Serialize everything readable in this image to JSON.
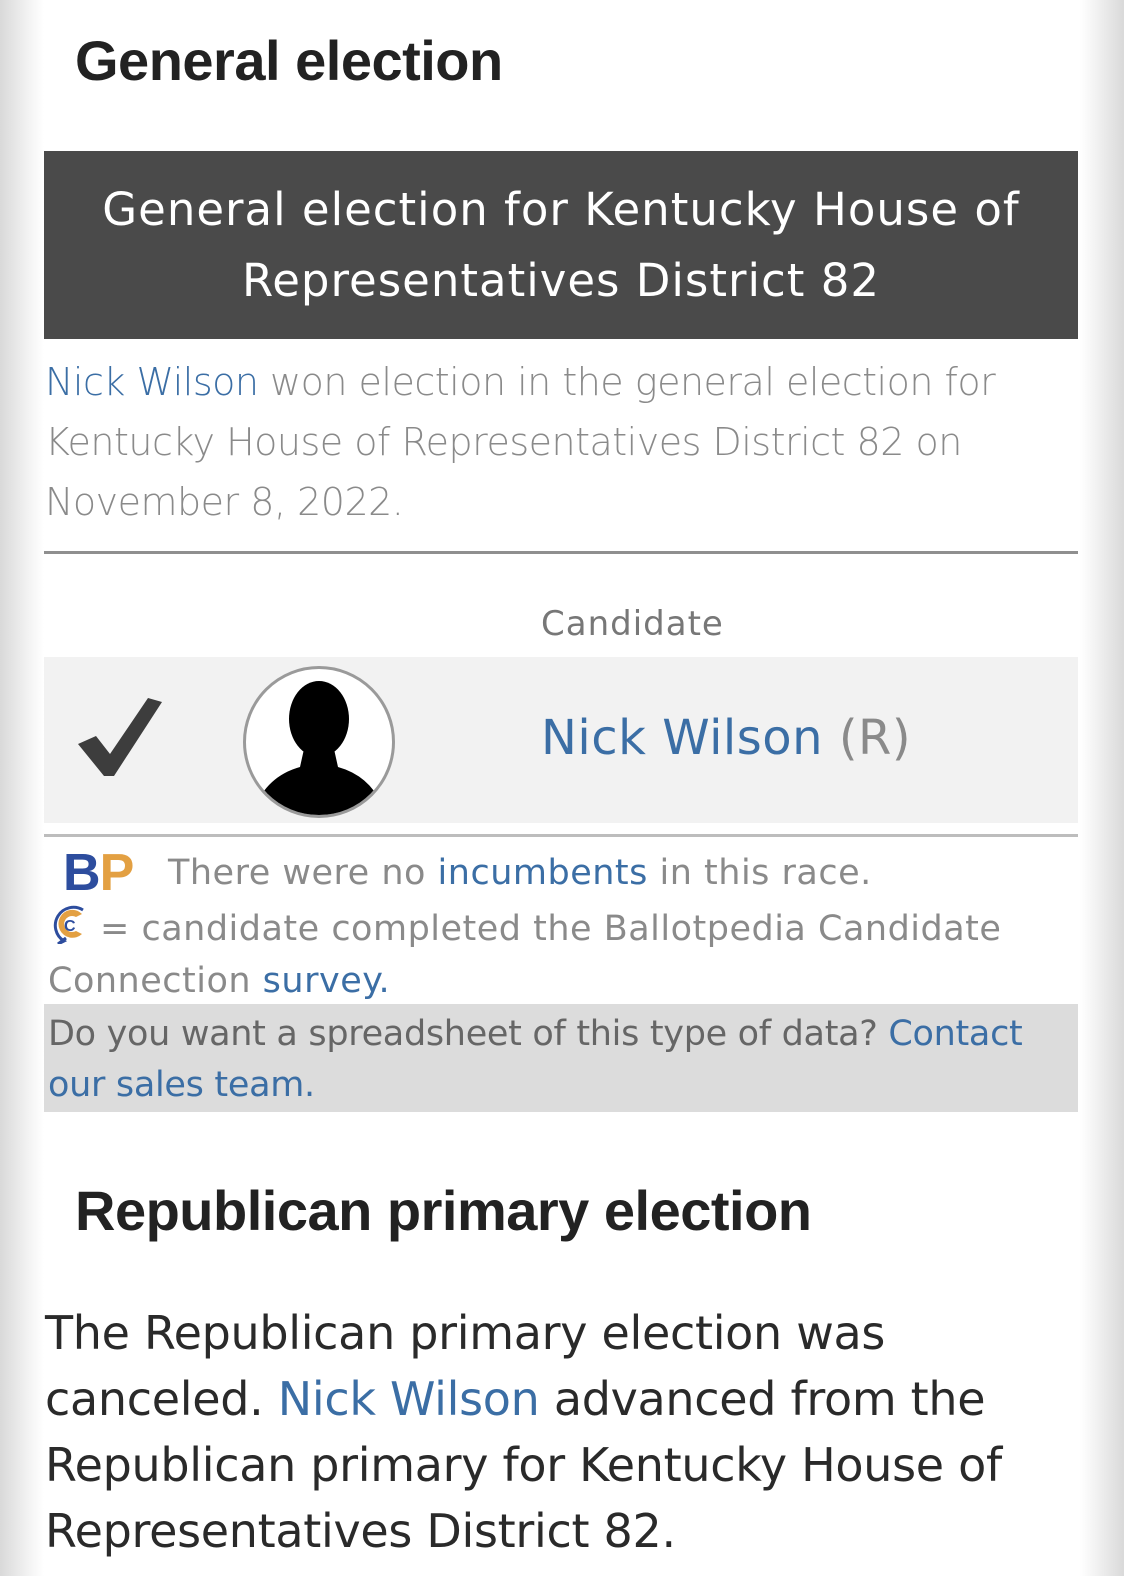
{
  "general": {
    "heading": "General election",
    "banner": "General election for Kentucky House of Representatives District 82",
    "result_link": "Nick Wilson",
    "result_text": " won election in the general election for Kentucky House of Representatives District 82 on November 8, 2022.",
    "column_header": "Candidate",
    "candidate": {
      "name": "Nick Wilson",
      "party": "(R)",
      "winner_icon": "checkmark-icon",
      "photo_icon": "person-silhouette-icon"
    },
    "incumbent_pre": "There were no ",
    "incumbent_link": "incumbents",
    "incumbent_post": " in this race.",
    "survey_text": "= candidate completed the Ballotpedia Candidate Connection ",
    "survey_link": "survey.",
    "sales_text": "Do you want a spreadsheet of this type of data? ",
    "sales_link": "Contact our sales team."
  },
  "logo": {
    "b": "B",
    "p": "P"
  },
  "primary": {
    "heading": "Republican primary election",
    "text_pre": "The Republican primary election was canceled. ",
    "text_link": "Nick Wilson",
    "text_post": " advanced from the Republican primary for Kentucky House of Representatives District 82."
  },
  "colors": {
    "link": "#3b6ea5",
    "banner_bg": "#4a4a4a",
    "bp_blue": "#2d4d9e",
    "bp_orange": "#e3a042"
  }
}
